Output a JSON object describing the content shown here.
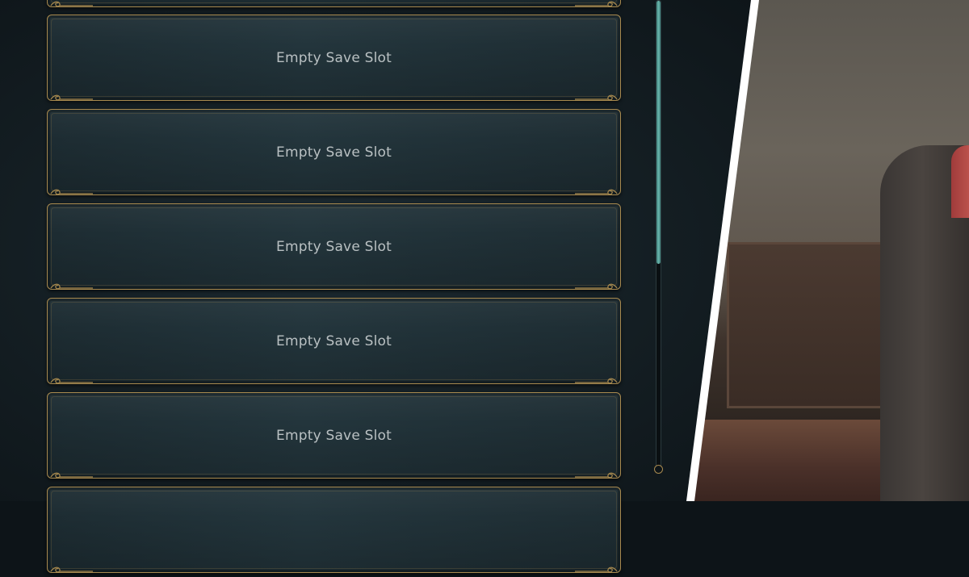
{
  "save_slots": [
    {
      "label": ""
    },
    {
      "label": "Empty Save Slot"
    },
    {
      "label": "Empty Save Slot"
    },
    {
      "label": "Empty Save Slot"
    },
    {
      "label": "Empty Save Slot"
    },
    {
      "label": "Empty Save Slot"
    },
    {
      "label": ""
    }
  ],
  "scrollbar": {
    "position_fraction": 0.56
  },
  "colors": {
    "panel_bg": "#1c2a31",
    "slot_border": "#a88a4f",
    "slot_text": "#b9c0c2",
    "scroll_thumb": "#6bb5ad",
    "divider": "#ffffff"
  }
}
